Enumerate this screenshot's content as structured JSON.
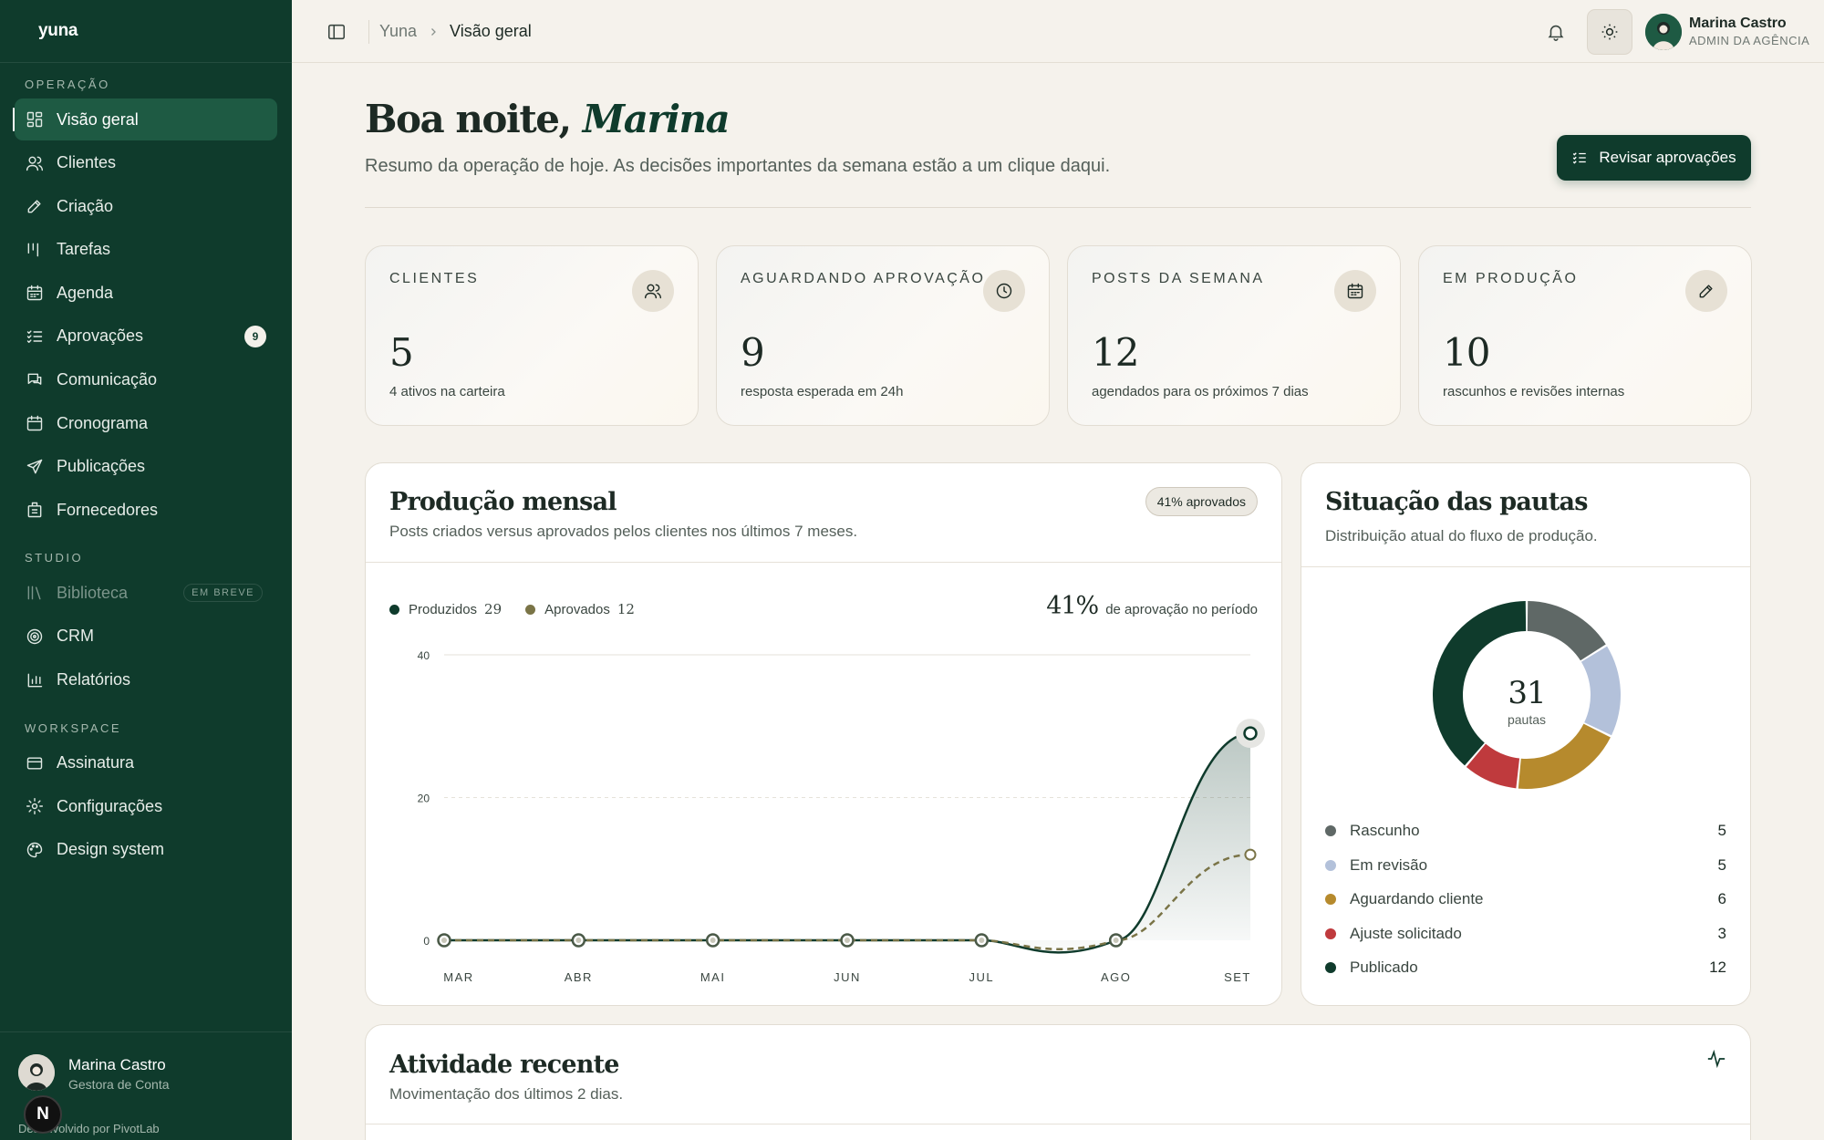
{
  "brand": "yuna",
  "sidebar": {
    "sections": [
      {
        "title": "OPERAÇÃO",
        "items": [
          {
            "label": "Visão geral",
            "icon": "dashboard-icon",
            "active": true
          },
          {
            "label": "Clientes",
            "icon": "users-icon"
          },
          {
            "label": "Criação",
            "icon": "pen-icon"
          },
          {
            "label": "Tarefas",
            "icon": "tasks-icon"
          },
          {
            "label": "Agenda",
            "icon": "calendar-icon"
          },
          {
            "label": "Aprovações",
            "icon": "checklist-icon",
            "badge": "9"
          },
          {
            "label": "Comunicação",
            "icon": "chat-icon"
          },
          {
            "label": "Cronograma",
            "icon": "schedule-icon"
          },
          {
            "label": "Publicações",
            "icon": "send-icon"
          },
          {
            "label": "Fornecedores",
            "icon": "building-icon"
          }
        ]
      },
      {
        "title": "STUDIO",
        "items": [
          {
            "label": "Biblioteca",
            "icon": "library-icon",
            "disabled": true,
            "tag": "EM BREVE"
          },
          {
            "label": "CRM",
            "icon": "target-icon"
          },
          {
            "label": "Relatórios",
            "icon": "bar-chart-icon"
          }
        ]
      },
      {
        "title": "WORKSPACE",
        "items": [
          {
            "label": "Assinatura",
            "icon": "card-icon"
          },
          {
            "label": "Configurações",
            "icon": "gear-icon"
          },
          {
            "label": "Design system",
            "icon": "palette-icon"
          }
        ]
      }
    ],
    "footer": {
      "name": "Marina Castro",
      "role": "Gestora de Conta",
      "credit": "Desenvolvido por PivotLab",
      "badge": "N"
    }
  },
  "topbar": {
    "breadcrumb": [
      "Yuna",
      "Visão geral"
    ],
    "user": {
      "name": "Marina Castro",
      "role": "ADMIN DA AGÊNCIA"
    }
  },
  "header": {
    "greeting": "Boa noite,",
    "name": "Marina",
    "subtitle": "Resumo da operação de hoje. As decisões importantes da semana estão a um clique daqui.",
    "cta": "Revisar aprovações"
  },
  "stats": [
    {
      "label": "CLIENTES",
      "value": "5",
      "desc": "4 ativos na carteira",
      "icon": "users-icon"
    },
    {
      "label": "AGUARDANDO APROVAÇÃO",
      "value": "9",
      "desc": "resposta esperada em 24h",
      "icon": "clock-icon"
    },
    {
      "label": "POSTS DA SEMANA",
      "value": "12",
      "desc": "agendados para os próximos 7 dias",
      "icon": "calendar-icon"
    },
    {
      "label": "EM PRODUÇÃO",
      "value": "10",
      "desc": "rascunhos e revisões internas",
      "icon": "pen-icon"
    }
  ],
  "production": {
    "title": "Produção mensal",
    "subtitle": "Posts criados versus aprovados pelos clientes nos últimos 7 meses.",
    "pill": "41% aprovados",
    "legend": [
      {
        "name": "Produzidos",
        "total": "29",
        "color": "#0f3b2c"
      },
      {
        "name": "Aprovados",
        "total": "12",
        "color": "#7a7447"
      }
    ],
    "rate_value": "41%",
    "rate_label": "de aprovação no período"
  },
  "chart_data": [
    {
      "type": "area",
      "categories": [
        "MAR",
        "ABR",
        "MAI",
        "JUN",
        "JUL",
        "AGO",
        "SET"
      ],
      "series": [
        {
          "name": "Produzidos",
          "values": [
            0,
            0,
            0,
            0,
            0,
            0,
            29
          ],
          "color": "#0f3b2c"
        },
        {
          "name": "Aprovados",
          "values": [
            0,
            0,
            0,
            0,
            0,
            0,
            12
          ],
          "color": "#7a7447"
        }
      ],
      "yticks": [
        0,
        20,
        40
      ],
      "ylim": [
        0,
        40
      ],
      "grid": true
    },
    {
      "type": "pie",
      "center_value": "31",
      "center_label": "pautas",
      "slices": [
        {
          "label": "Publicado",
          "value": 12,
          "color": "#0f3b2c"
        },
        {
          "label": "Rascunho",
          "value": 5,
          "color": "#5f6866"
        },
        {
          "label": "Em revisão",
          "value": 5,
          "color": "#b3c1da"
        },
        {
          "label": "Aguardando cliente",
          "value": 6,
          "color": "#b68a2d"
        },
        {
          "label": "Ajuste solicitado",
          "value": 3,
          "color": "#bf3a3d"
        }
      ]
    }
  ],
  "status": {
    "title": "Situação das pautas",
    "subtitle": "Distribuição atual do fluxo de produção.",
    "legend": [
      {
        "label": "Rascunho",
        "count": "5",
        "color": "#5f6866"
      },
      {
        "label": "Em revisão",
        "count": "5",
        "color": "#b3c1da"
      },
      {
        "label": "Aguardando cliente",
        "count": "6",
        "color": "#b68a2d"
      },
      {
        "label": "Ajuste solicitado",
        "count": "3",
        "color": "#bf3a3d"
      },
      {
        "label": "Publicado",
        "count": "12",
        "color": "#0f3b2c"
      }
    ]
  },
  "activity": {
    "title": "Atividade recente",
    "subtitle": "Movimentação dos últimos 2 dias."
  }
}
